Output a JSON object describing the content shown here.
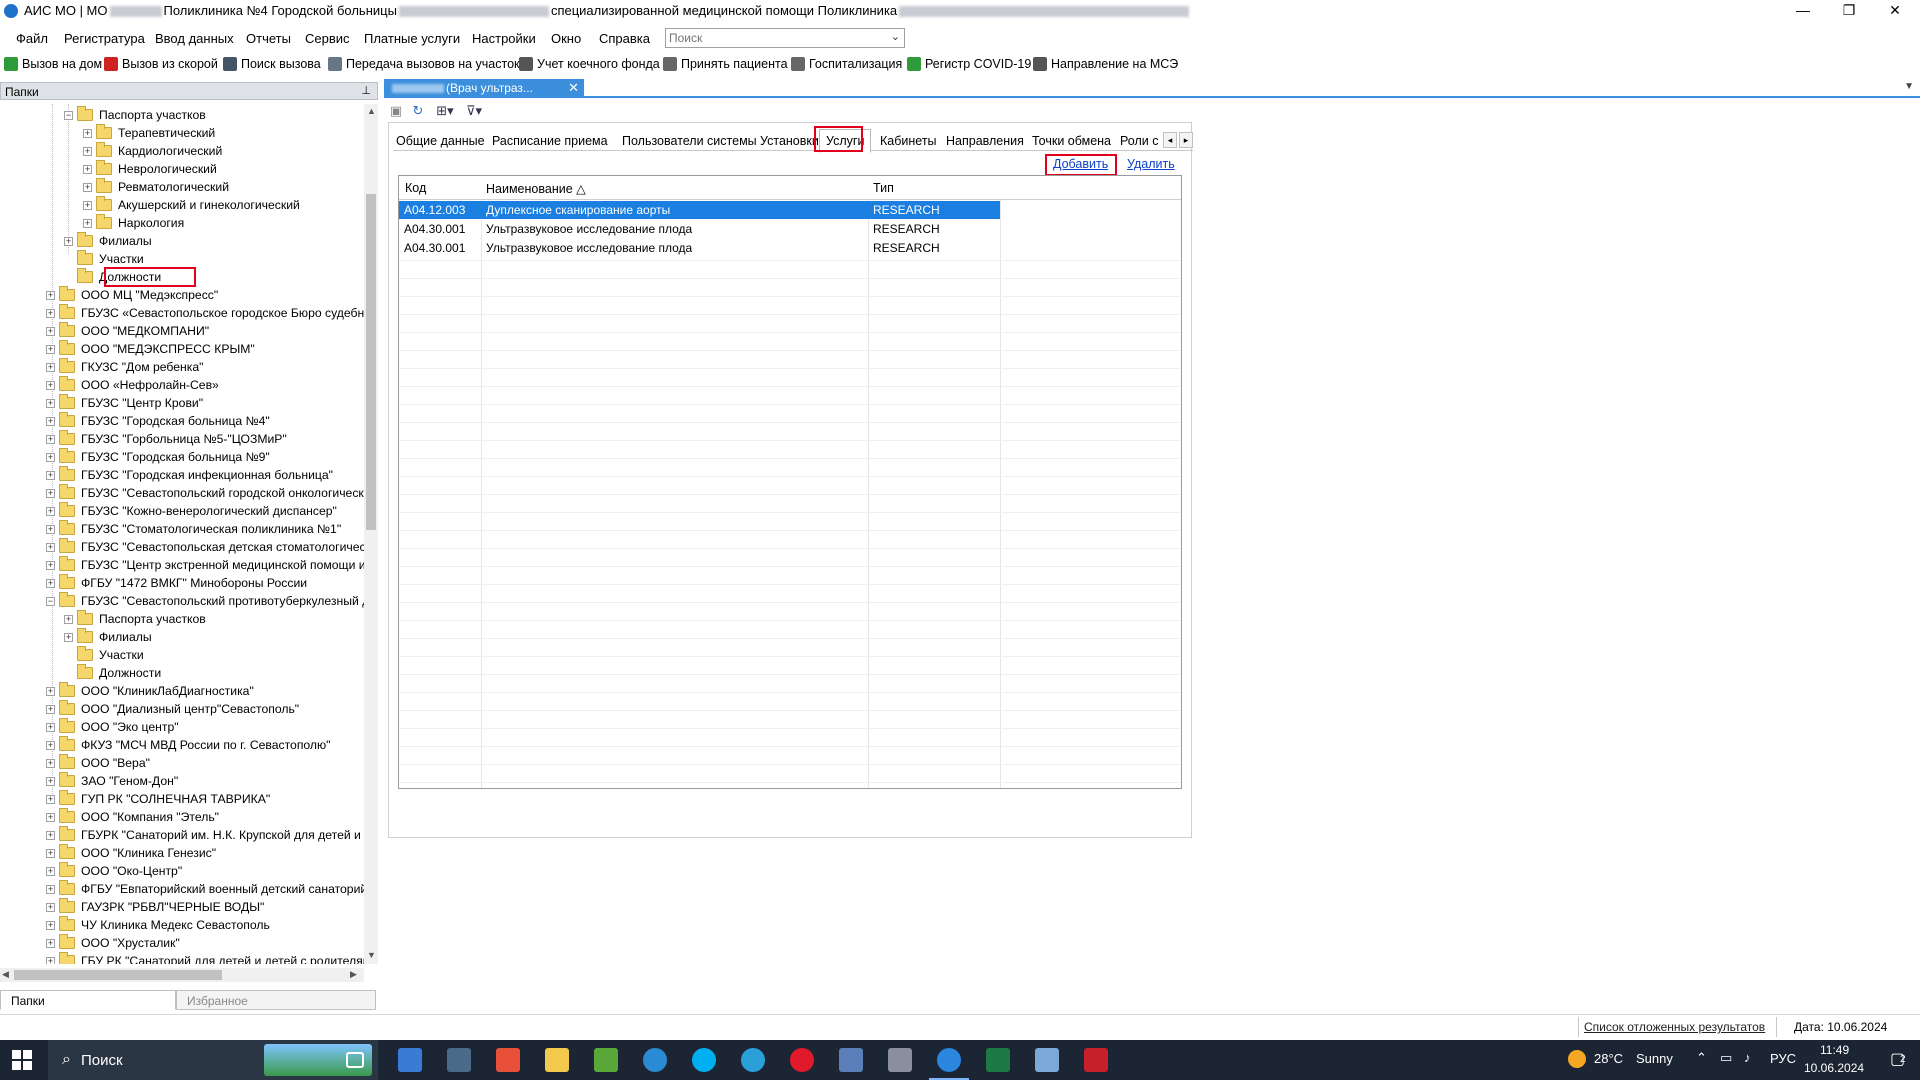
{
  "window": {
    "title_prefix": "АИС МО | МО",
    "title_part2": "Поликлиника №4 Городской больницы",
    "title_part3": "специализированной медицинской помощи Поликлиника",
    "controls": {
      "minimize": "—",
      "maximize": "❐",
      "close": "✕"
    }
  },
  "menu": {
    "items": [
      "Файл",
      "Регистратура",
      "Ввод данных",
      "Отчеты",
      "Сервис",
      "Платные услуги",
      "Настройки",
      "Окно",
      "Справка"
    ],
    "search_placeholder": "Поиск"
  },
  "toolbar": {
    "items": [
      {
        "label": "Вызов на дом",
        "icon": "home-call-icon",
        "color": "#2e9a3a"
      },
      {
        "label": "Вызов из скорой",
        "icon": "ambulance-icon",
        "color": "#d02020"
      },
      {
        "label": "Поиск вызова",
        "icon": "search-call-icon",
        "color": "#445566"
      },
      {
        "label": "Передача вызовов на участок",
        "icon": "transfer-icon",
        "color": "#667788"
      },
      {
        "label": "Учет коечного фонда",
        "icon": "bed-icon",
        "color": "#555555"
      },
      {
        "label": "Принять пациента",
        "icon": "accept-patient-icon",
        "color": "#666666"
      },
      {
        "label": "Госпитализация",
        "icon": "hospitalization-icon",
        "color": "#666666"
      },
      {
        "label": "Регистр COVID-19",
        "icon": "virus-icon",
        "color": "#2e9a3a"
      },
      {
        "label": "Направление на МСЭ",
        "icon": "mse-icon",
        "color": "#555555"
      }
    ]
  },
  "left_panel": {
    "header": "Папки",
    "tree": [
      {
        "label": "Паспорта участков",
        "level": 3,
        "expander": "minus"
      },
      {
        "label": "Терапевтический",
        "level": 4,
        "expander": "plus"
      },
      {
        "label": "Кардиологический",
        "level": 4,
        "expander": "plus"
      },
      {
        "label": "Неврологический",
        "level": 4,
        "expander": "plus"
      },
      {
        "label": "Ревматологический",
        "level": 4,
        "expander": "plus"
      },
      {
        "label": "Акушерский и гинекологический",
        "level": 4,
        "expander": "plus"
      },
      {
        "label": "Наркология",
        "level": 4,
        "expander": "plus"
      },
      {
        "label": "Филиалы",
        "level": 3,
        "expander": "plus"
      },
      {
        "label": "Участки",
        "level": 3,
        "expander": "none"
      },
      {
        "label": "Должности",
        "level": 3,
        "expander": "none",
        "highlighted": true
      },
      {
        "label": "ООО МЦ \"Медэкспресс\"",
        "level": 2,
        "expander": "plus"
      },
      {
        "label": "ГБУЗС «Севастопольское городское Бюро судебно",
        "level": 2,
        "expander": "plus"
      },
      {
        "label": "ООО \"МЕДКОМПАНИ\"",
        "level": 2,
        "expander": "plus"
      },
      {
        "label": "ООО \"МЕДЭКСПРЕСС КРЫМ\"",
        "level": 2,
        "expander": "plus"
      },
      {
        "label": "ГКУЗС \"Дом ребенка\"",
        "level": 2,
        "expander": "plus"
      },
      {
        "label": "ООО «Нефролайн-Сев»",
        "level": 2,
        "expander": "plus"
      },
      {
        "label": "ГБУЗС \"Центр Крови\"",
        "level": 2,
        "expander": "plus"
      },
      {
        "label": "ГБУЗС \"Городская больница №4\"",
        "level": 2,
        "expander": "plus"
      },
      {
        "label": "ГБУЗС \"Горбольница №5-\"ЦОЗМиР\"",
        "level": 2,
        "expander": "plus"
      },
      {
        "label": "ГБУЗС \"Городская больница №9\"",
        "level": 2,
        "expander": "plus"
      },
      {
        "label": "ГБУЗС \"Городская инфекционная больница\"",
        "level": 2,
        "expander": "plus"
      },
      {
        "label": "ГБУЗС \"Севастопольский городской онкологическ",
        "level": 2,
        "expander": "plus"
      },
      {
        "label": "ГБУЗС \"Кожно-венерологический диспансер\"",
        "level": 2,
        "expander": "plus"
      },
      {
        "label": "ГБУЗС \"Стоматологическая поликлиника №1\"",
        "level": 2,
        "expander": "plus"
      },
      {
        "label": "ГБУЗС \"Севастопольская детская стоматологическ",
        "level": 2,
        "expander": "plus"
      },
      {
        "label": "ГБУЗС \"Центр экстренной медицинской помощи и",
        "level": 2,
        "expander": "plus"
      },
      {
        "label": "ФГБУ \"1472 ВМКГ\" Минобороны России",
        "level": 2,
        "expander": "plus"
      },
      {
        "label": "ГБУЗС \"Севастопольский противотуберкулезный д",
        "level": 2,
        "expander": "minus"
      },
      {
        "label": "Паспорта участков",
        "level": 3,
        "expander": "plus"
      },
      {
        "label": "Филиалы",
        "level": 3,
        "expander": "plus"
      },
      {
        "label": "Участки",
        "level": 3,
        "expander": "none"
      },
      {
        "label": "Должности",
        "level": 3,
        "expander": "none"
      },
      {
        "label": "ООО \"КлиникЛабДиагностика\"",
        "level": 2,
        "expander": "plus"
      },
      {
        "label": "ООО \"Диализный центр\"Севастополь\"",
        "level": 2,
        "expander": "plus"
      },
      {
        "label": "ООО \"Эко центр\"",
        "level": 2,
        "expander": "plus"
      },
      {
        "label": "ФКУЗ \"МСЧ МВД России по г. Севастополю\"",
        "level": 2,
        "expander": "plus"
      },
      {
        "label": "ООО \"Вера\"",
        "level": 2,
        "expander": "plus"
      },
      {
        "label": "ЗАО \"Геном-Дон\"",
        "level": 2,
        "expander": "plus"
      },
      {
        "label": "ГУП РК \"СОЛНЕЧНАЯ ТАВРИКА\"",
        "level": 2,
        "expander": "plus"
      },
      {
        "label": "ООО \"Компания \"Этель\"",
        "level": 2,
        "expander": "plus"
      },
      {
        "label": "ГБУРК \"Санаторий им. Н.К. Крупской для детей и д",
        "level": 2,
        "expander": "plus"
      },
      {
        "label": "ООО \"Клиника Генезис\"",
        "level": 2,
        "expander": "plus"
      },
      {
        "label": "ООО \"Око-Центр\"",
        "level": 2,
        "expander": "plus"
      },
      {
        "label": "ФГБУ \"Евпаторийский военный детский санаторий",
        "level": 2,
        "expander": "plus"
      },
      {
        "label": "ГАУЗРК \"РБВЛ\"ЧЕРНЫЕ ВОДЫ\"",
        "level": 2,
        "expander": "plus"
      },
      {
        "label": "ЧУ Клиника Медекс Севастополь",
        "level": 2,
        "expander": "plus"
      },
      {
        "label": "ООО \"Хрусталик\"",
        "level": 2,
        "expander": "plus"
      },
      {
        "label": "ГБУ РК \"Санаторий для детей и детей с родителями",
        "level": 2,
        "expander": "plus"
      }
    ],
    "bottom_tabs": [
      "Папки",
      "Избранное"
    ]
  },
  "document": {
    "tab_title": "(Врач ультраз...",
    "close": "✕",
    "tabs": [
      "Общие данные",
      "Расписание приема",
      "Пользователи системы",
      "Установки",
      "Услуги",
      "Кабинеты",
      "Направления",
      "Точки обмена",
      "Роли с"
    ],
    "active_tab": "Услуги",
    "actions": {
      "add": "Добавить",
      "delete": "Удалить"
    },
    "grid": {
      "columns": [
        "Код",
        "Наименование",
        "Тип"
      ],
      "sort_indicator": "△",
      "rows": [
        {
          "code": "A04.12.003",
          "name": "Дуплексное сканирование аорты",
          "type": "RESEARCH"
        },
        {
          "code": "A04.30.001",
          "name": "Ультразвуковое исследование плода",
          "type": "RESEARCH"
        },
        {
          "code": "A04.30.001",
          "name": "Ультразвуковое исследование плода",
          "type": "RESEARCH"
        }
      ]
    }
  },
  "status": {
    "pending_link": "Список отложенных результатов",
    "date": "Дата: 10.06.2024"
  },
  "taskbar": {
    "search_label": "Поиск",
    "weather_temp": "28°C",
    "weather_text": "Sunny",
    "lang": "РУС",
    "time": "11:49",
    "date": "10.06.2024",
    "notification_count": "2",
    "colors": {
      "accent": "#3c8fdc",
      "selection": "#1a7fe0",
      "highlight_box": "#e0001b"
    }
  }
}
